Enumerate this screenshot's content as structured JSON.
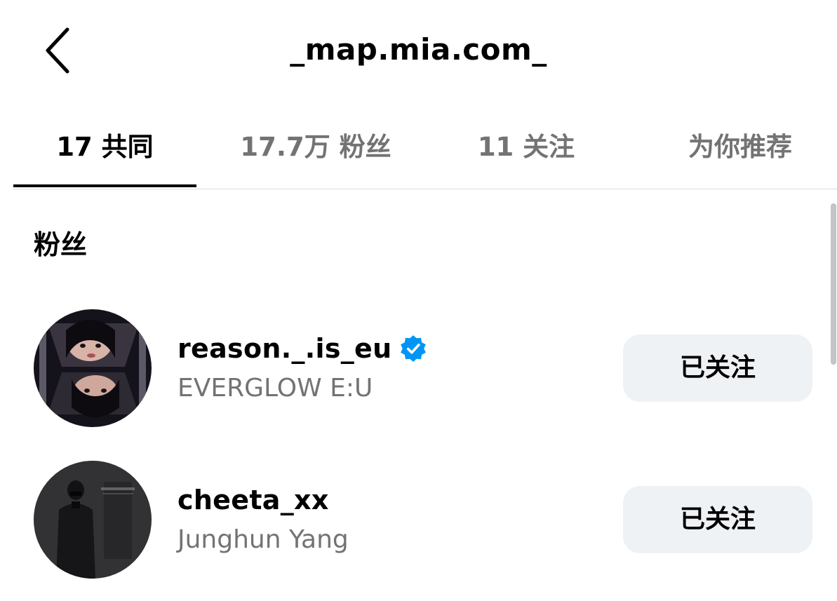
{
  "header": {
    "back_icon": "chevron-left-icon",
    "title": "_map.mia.com_"
  },
  "tabs": [
    {
      "label": "17 共同",
      "active": true
    },
    {
      "label": "17.7万 粉丝",
      "active": false
    },
    {
      "label": "11 关注",
      "active": false
    },
    {
      "label": "为你推荐",
      "active": false
    }
  ],
  "section": {
    "title": "粉丝"
  },
  "users": [
    {
      "username": "reason._.is_eu",
      "verified": true,
      "fullname": "EVERGLOW E:U",
      "button_label": "已关注"
    },
    {
      "username": "cheeta_xx",
      "verified": false,
      "fullname": "Junghun Yang",
      "button_label": "已关注"
    }
  ],
  "colors": {
    "text_primary": "#000000",
    "text_secondary": "#737373",
    "button_bg": "#eff2f5",
    "verified_blue": "#0095f6",
    "divider": "#dbdbdb"
  }
}
